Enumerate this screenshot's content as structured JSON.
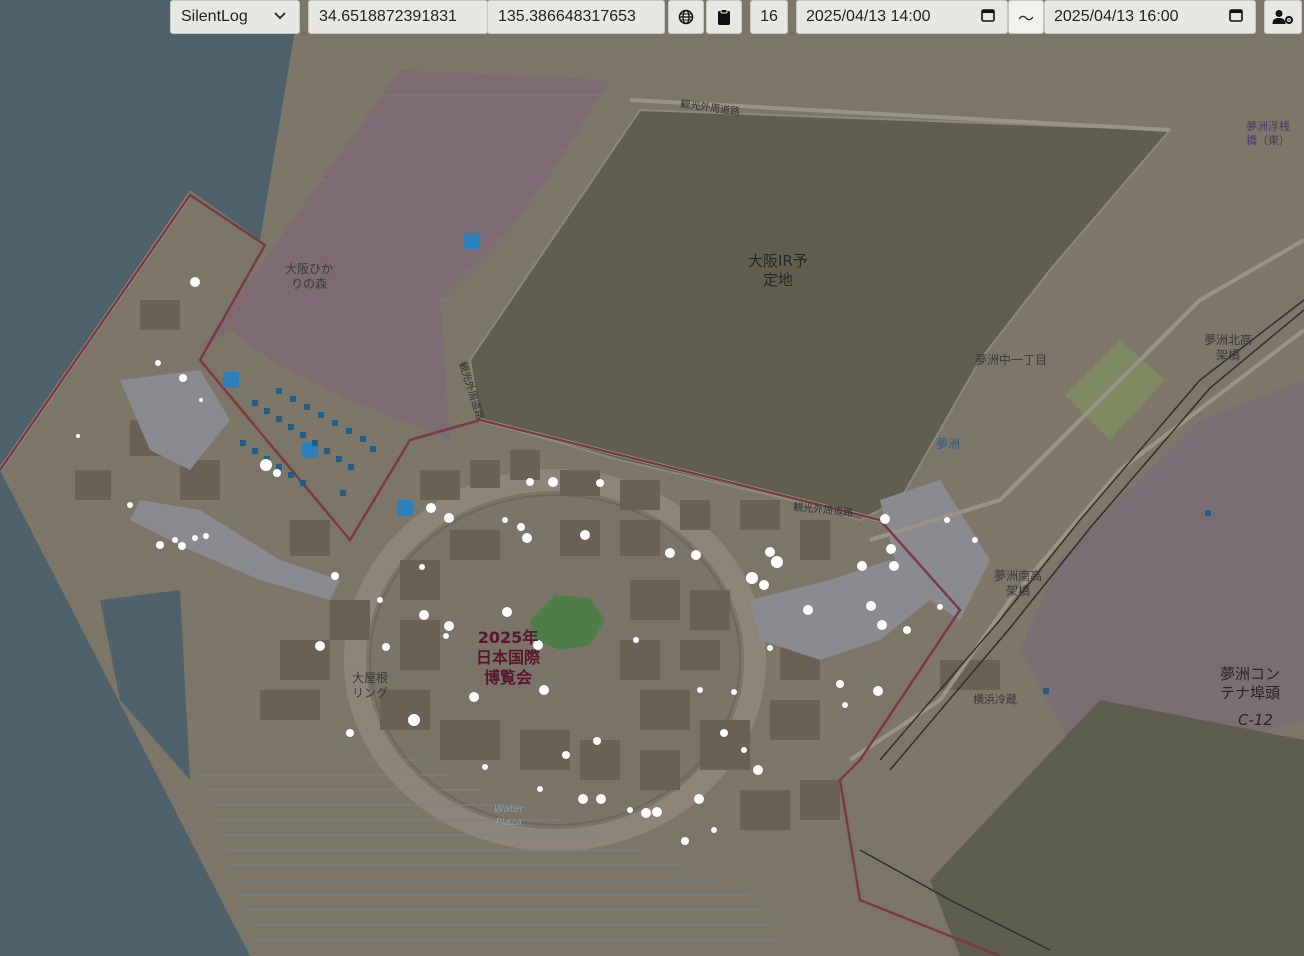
{
  "toolbar": {
    "mode_select": {
      "value": "SilentLog",
      "options": [
        "SilentLog"
      ]
    },
    "latitude": "34.6518872391831",
    "longitude": "135.386648317653",
    "zoom": "16",
    "start_datetime": "2025/04/13 14:00",
    "separator": "〜",
    "end_datetime": "2025/04/13 16:00",
    "icons": {
      "globe": "globe-icon",
      "clipboard": "clipboard-icon",
      "calendar": "calendar-icon",
      "user_settings": "user-gear-icon",
      "dropdown": "chevron-down-icon"
    }
  },
  "map": {
    "labels": {
      "forest": "大阪ひか\nりの森",
      "ir": "大阪IR予\n定地",
      "expo": "2025年\n日本国際\n博覧会",
      "ring": "大屋根\nリング",
      "water_plaza": "Water\nPlaza",
      "yumeshima_1chome": "夢洲中一丁目",
      "yumeshima": "夢洲",
      "kitakoka": "夢洲北高\n架橋",
      "minamikoka": "夢洲南高\n架橋",
      "container": "夢洲コン\nテナ埠頭",
      "c12": "C-12",
      "pier": "夢洲浮桟\n橋（東）",
      "yokohama_reizo": "横浜冷蔵",
      "road_north": "観光外周道路",
      "road_south": "観光外周道路",
      "road_west": "観光外周道路"
    },
    "colors": {
      "water": "#4f626b",
      "land": "#7b7667",
      "ir_site": "#5f5e4f",
      "park": "#7e6a72",
      "building": "#6a6054",
      "pavement": "#8a8b90",
      "boundary": "#7a3a45",
      "green": "#4f7d4a",
      "point": "#ffffff",
      "point_glow": "#8fd0ff"
    }
  }
}
